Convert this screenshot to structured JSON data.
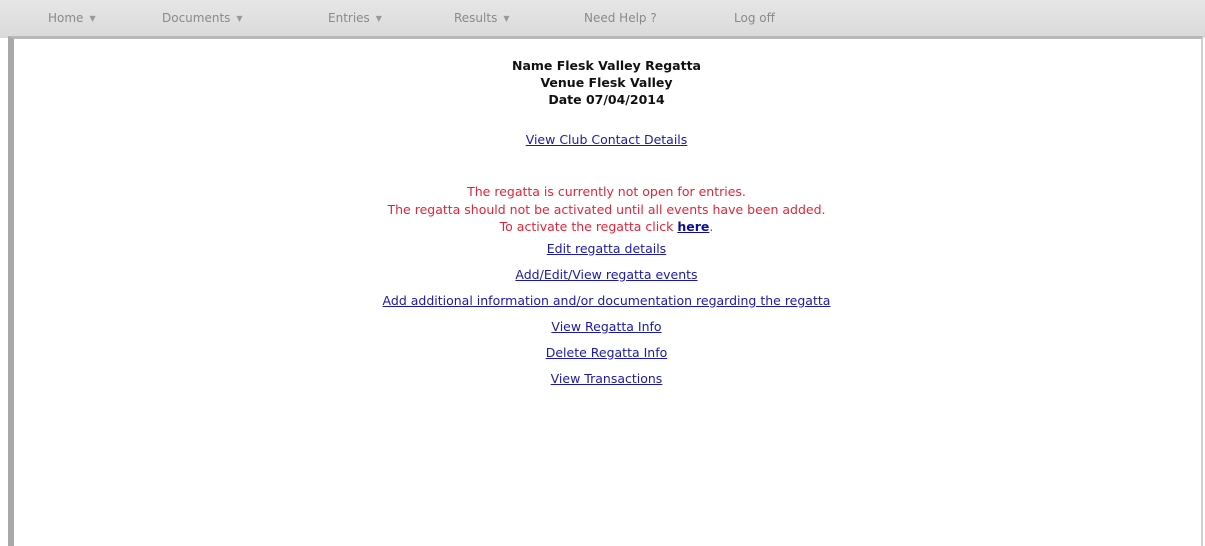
{
  "nav": {
    "items": [
      {
        "label": "Home",
        "has_dropdown": true
      },
      {
        "label": "Documents",
        "has_dropdown": true
      },
      {
        "label": "Entries",
        "has_dropdown": true
      },
      {
        "label": "Results",
        "has_dropdown": true
      },
      {
        "label": "Need Help ?",
        "has_dropdown": false
      },
      {
        "label": "Log off",
        "has_dropdown": false
      }
    ]
  },
  "regatta": {
    "name_line": "Name Flesk Valley Regatta",
    "venue_line": "Venue Flesk Valley",
    "date_line": "Date 07/04/2014"
  },
  "links": {
    "club_contact": "View Club Contact Details",
    "edit_details": "Edit regatta details",
    "events": "Add/Edit/View regatta events",
    "additional_info": "Add additional information and/or documentation regarding the regatta",
    "view_info": "View Regatta Info",
    "delete_info": "Delete Regatta Info",
    "transactions": "View Transactions"
  },
  "warning": {
    "line1": "The regatta is currently not open for entries.",
    "line2": "The regatta should not be activated until all events have been added.",
    "line3_prefix": "To activate the regatta click ",
    "here_link": "here",
    "line3_suffix": "."
  },
  "colors": {
    "warning": "#e2243a",
    "link": "#1a1aaa",
    "nav_text": "#8a8a8a",
    "nav_bg": "#dedede"
  }
}
